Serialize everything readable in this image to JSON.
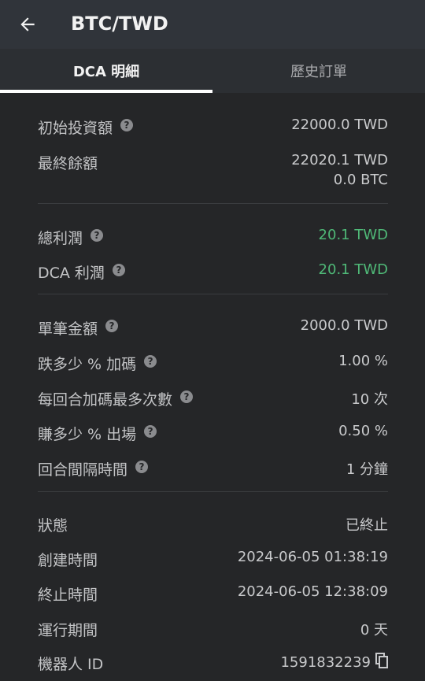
{
  "appbar": {
    "title": "BTC/TWD",
    "back_icon": "arrow-left-icon"
  },
  "tabs": [
    {
      "label": "DCA 明細",
      "active": true
    },
    {
      "label": "歷史訂單",
      "active": false
    }
  ],
  "summary": {
    "initial_investment": {
      "label": "初始投資額",
      "value": "22000.0 TWD"
    },
    "final_balance": {
      "label": "最終餘額",
      "value_1": "22020.1 TWD",
      "value_2": "0.0 BTC"
    }
  },
  "profit": {
    "total_profit": {
      "label": "總利潤",
      "value": "20.1 TWD"
    },
    "dca_profit": {
      "label": "DCA 利潤",
      "value": "20.1 TWD"
    }
  },
  "settings": {
    "single_amount": {
      "label": "單筆金額",
      "value": "2000.0 TWD"
    },
    "drop_percent": {
      "label": "跌多少 % 加碼",
      "value": "1.00 %"
    },
    "max_addons": {
      "label": "每回合加碼最多次數",
      "value": "10 次"
    },
    "profit_percent": {
      "label": "賺多少 % 出場",
      "value": "0.50 %"
    },
    "round_interval": {
      "label": "回合間隔時間",
      "value": "1 分鐘"
    }
  },
  "info": {
    "status": {
      "label": "狀態",
      "value": "已終止"
    },
    "created_at": {
      "label": "創建時間",
      "value": "2024-06-05 01:38:19"
    },
    "ended_at": {
      "label": "終止時間",
      "value": "2024-06-05 12:38:09"
    },
    "duration": {
      "label": "運行期間",
      "value": "0 天"
    },
    "bot_id": {
      "label": "機器人 ID",
      "value": "1591832239"
    }
  },
  "colors": {
    "profit_green": "#4fb877",
    "appbar_bg": "#30343a",
    "page_bg": "#252628"
  }
}
